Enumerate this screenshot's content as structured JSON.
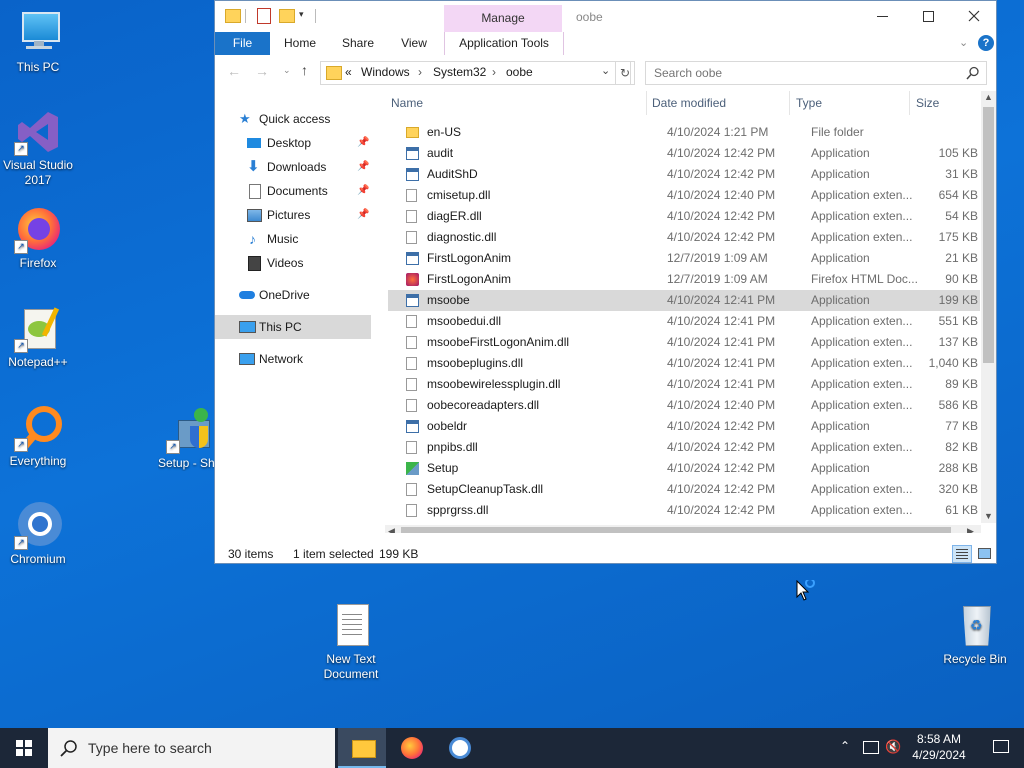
{
  "desktop": {
    "icons": [
      {
        "label": "This PC"
      },
      {
        "label": "Visual Studio 2017"
      },
      {
        "label": "Firefox"
      },
      {
        "label": "Notepad++"
      },
      {
        "label": "Everything"
      },
      {
        "label": "Chromium"
      },
      {
        "label": "Setup - Shortcut"
      },
      {
        "label": "New Text Document"
      },
      {
        "label": "Recycle Bin"
      }
    ]
  },
  "window": {
    "title": "oobe",
    "context_tab_group": "Manage",
    "ribbon_tabs": [
      "File",
      "Home",
      "Share",
      "View",
      "Application Tools"
    ],
    "address": {
      "overflow": "«",
      "crumbs": [
        "Windows",
        "System32",
        "oobe"
      ],
      "sep": "›"
    },
    "search_placeholder": "Search oobe",
    "nav": {
      "quick_access": "Quick access",
      "items": [
        "Desktop",
        "Downloads",
        "Documents",
        "Pictures",
        "Music",
        "Videos"
      ],
      "onedrive": "OneDrive",
      "this_pc": "This PC",
      "network": "Network"
    },
    "columns": {
      "name": "Name",
      "date": "Date modified",
      "type": "Type",
      "size": "Size"
    },
    "files": [
      {
        "name": "en-US",
        "date": "4/10/2024 1:21 PM",
        "type": "File folder",
        "size": "",
        "icon": "folder"
      },
      {
        "name": "audit",
        "date": "4/10/2024 12:42 PM",
        "type": "Application",
        "size": "105 KB",
        "icon": "app"
      },
      {
        "name": "AuditShD",
        "date": "4/10/2024 12:42 PM",
        "type": "Application",
        "size": "31 KB",
        "icon": "app"
      },
      {
        "name": "cmisetup.dll",
        "date": "4/10/2024 12:40 PM",
        "type": "Application exten...",
        "size": "654 KB",
        "icon": "dll"
      },
      {
        "name": "diagER.dll",
        "date": "4/10/2024 12:42 PM",
        "type": "Application exten...",
        "size": "54 KB",
        "icon": "dll"
      },
      {
        "name": "diagnostic.dll",
        "date": "4/10/2024 12:42 PM",
        "type": "Application exten...",
        "size": "175 KB",
        "icon": "dll"
      },
      {
        "name": "FirstLogonAnim",
        "date": "12/7/2019 1:09 AM",
        "type": "Application",
        "size": "21 KB",
        "icon": "app"
      },
      {
        "name": "FirstLogonAnim",
        "date": "12/7/2019 1:09 AM",
        "type": "Firefox HTML Doc...",
        "size": "90 KB",
        "icon": "html"
      },
      {
        "name": "msoobe",
        "date": "4/10/2024 12:41 PM",
        "type": "Application",
        "size": "199 KB",
        "icon": "app"
      },
      {
        "name": "msoobedui.dll",
        "date": "4/10/2024 12:41 PM",
        "type": "Application exten...",
        "size": "551 KB",
        "icon": "dll"
      },
      {
        "name": "msoobeFirstLogonAnim.dll",
        "date": "4/10/2024 12:41 PM",
        "type": "Application exten...",
        "size": "137 KB",
        "icon": "dll"
      },
      {
        "name": "msoobeplugins.dll",
        "date": "4/10/2024 12:41 PM",
        "type": "Application exten...",
        "size": "1,040 KB",
        "icon": "dll"
      },
      {
        "name": "msoobewirelessplugin.dll",
        "date": "4/10/2024 12:41 PM",
        "type": "Application exten...",
        "size": "89 KB",
        "icon": "dll"
      },
      {
        "name": "oobecoreadapters.dll",
        "date": "4/10/2024 12:40 PM",
        "type": "Application exten...",
        "size": "586 KB",
        "icon": "dll"
      },
      {
        "name": "oobeldr",
        "date": "4/10/2024 12:42 PM",
        "type": "Application",
        "size": "77 KB",
        "icon": "app"
      },
      {
        "name": "pnpibs.dll",
        "date": "4/10/2024 12:42 PM",
        "type": "Application exten...",
        "size": "82 KB",
        "icon": "dll"
      },
      {
        "name": "Setup",
        "date": "4/10/2024 12:42 PM",
        "type": "Application",
        "size": "288 KB",
        "icon": "setup"
      },
      {
        "name": "SetupCleanupTask.dll",
        "date": "4/10/2024 12:42 PM",
        "type": "Application exten...",
        "size": "320 KB",
        "icon": "dll"
      },
      {
        "name": "spprgrss.dll",
        "date": "4/10/2024 12:42 PM",
        "type": "Application exten...",
        "size": "61 KB",
        "icon": "dll"
      }
    ],
    "status": {
      "items": "30 items",
      "selected": "1 item selected",
      "size": "199 KB"
    }
  },
  "taskbar": {
    "search_placeholder": "Type here to search",
    "time": "8:58 AM",
    "date": "4/29/2024"
  }
}
